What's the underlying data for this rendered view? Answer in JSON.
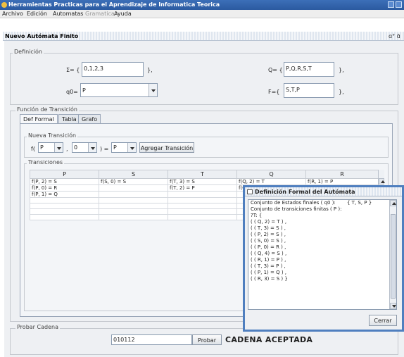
{
  "window": {
    "title": "Herramientas Practicas para el Aprendizaje de Informatica Teorica"
  },
  "menu": [
    {
      "label": "Archivo",
      "enabled": true
    },
    {
      "label": "Edición",
      "enabled": true
    },
    {
      "label": "Automatas",
      "enabled": true
    },
    {
      "label": "Gramatica",
      "enabled": false
    },
    {
      "label": "Ayuda",
      "enabled": true
    }
  ],
  "internal_frame": {
    "title": "Nuevo Autómata Finito",
    "controls": "ɑ° ɑ̃"
  },
  "definicion": {
    "legend": "Definición",
    "sigma_label": "Σ= {",
    "sigma_value": "0,1,2,3",
    "q_label": "Q= {",
    "q_value": "P,Q,R,S,T",
    "q0_label": "q0=",
    "q0_value": "P",
    "f_label": "F={",
    "f_value": "S,T,P",
    "close_brace": "},"
  },
  "funcion": {
    "legend": "Función de Transición",
    "tabs": [
      "Def Formal",
      "Tabla",
      "Grafo"
    ],
    "nueva": {
      "legend": "Nueva Transición",
      "f_open": "f(",
      "state_value": "P",
      "comma": ",",
      "symbol_value": "0",
      "close_eq": ") =",
      "result_value": "P",
      "button": "Agregar Transición"
    },
    "transiciones": {
      "legend": "Transiciones",
      "columns": [
        "P",
        "S",
        "T",
        "Q",
        "R"
      ],
      "rows": [
        [
          "f(P, 2) = S",
          "f(S, 0) = S",
          "f(T, 3) = S",
          "f(Q, 2) = T",
          "f(R, 1) = P"
        ],
        [
          "f(P, 0) = R",
          "",
          "f(T, 2) = P",
          "f(Q",
          ""
        ],
        [
          "f(P, 1) = Q",
          "",
          "",
          "",
          ""
        ],
        [
          "",
          "",
          "",
          "",
          ""
        ],
        [
          "",
          "",
          "",
          "",
          ""
        ],
        [
          "",
          "",
          "",
          "",
          ""
        ],
        [
          "",
          "",
          "",
          "",
          ""
        ]
      ]
    }
  },
  "probar": {
    "legend": "Probar Cadena",
    "input_value": "010112",
    "button": "Probar",
    "result": "CADENA ACEPTADA"
  },
  "dialog": {
    "title": "Definición Formal del Autómata",
    "line_finals_label": "Conjunto de Estados finales ( q0 ):",
    "line_finals_value": "{ T, S, P }",
    "lines": [
      "Conjunto de transiciones finitas ( P ):",
      "?T: {",
      "( ( Q, 2) = T ) ,",
      "( ( T, 3) = S ) ,",
      "( ( P, 2) = S ) ,",
      "( ( S, 0) = S ) ,",
      "( ( P, 0) = R ) ,",
      "( ( Q, 4) = S ) ,",
      "( ( R, 1) = P ) ,",
      "( ( T, 3) = P ) ,",
      "( ( P, 1) = Q ) ,",
      "( ( R, 3) = S ) }"
    ],
    "close_button": "Cerrar"
  },
  "colors": {
    "accent": "#4f7fbf",
    "titlebar": "#2b5aa0",
    "panel": "#eef0f3"
  }
}
